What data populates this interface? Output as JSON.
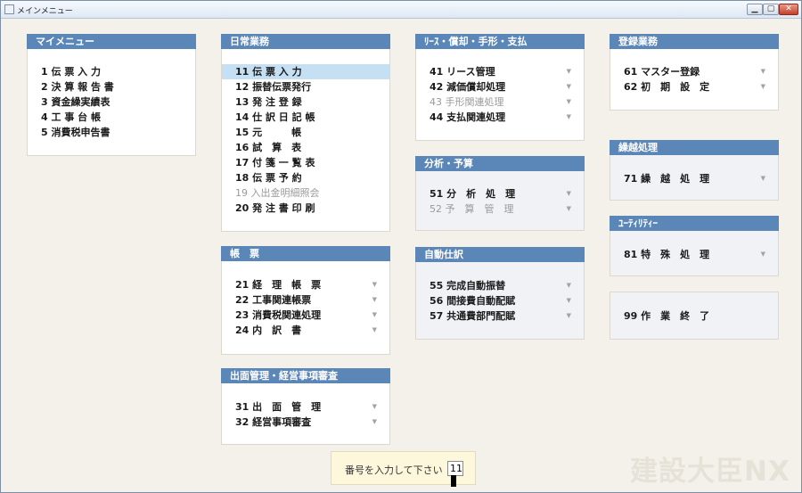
{
  "window": {
    "title": "メインメニュー",
    "controls": {
      "minimize": "▁",
      "maximize": "▢",
      "close": "✕"
    }
  },
  "panels": {
    "mymenu": {
      "title": "マイメニュー",
      "items": [
        {
          "label": "1 伝 票 入 力"
        },
        {
          "label": "2 決 算 報 告 書"
        },
        {
          "label": "3 資金繰実績表"
        },
        {
          "label": "4 工 事 台 帳"
        },
        {
          "label": "5 消費税申告書"
        }
      ]
    },
    "daily": {
      "title": "日常業務",
      "items": [
        {
          "label": "11 伝 票 入 力",
          "selected": true
        },
        {
          "label": "12 振替伝票発行"
        },
        {
          "label": "13 発 注 登 録"
        },
        {
          "label": "14 仕 訳 日 記 帳"
        },
        {
          "label": "15 元　　　帳"
        },
        {
          "label": "16 試　算　表"
        },
        {
          "label": "17 付 箋 一 覧 表"
        },
        {
          "label": "18 伝 票 予 約"
        },
        {
          "label": "19 入出金明細照会",
          "disabled": true
        },
        {
          "label": "20 発 注 書 印 刷"
        }
      ]
    },
    "ledger": {
      "title": "帳　票",
      "items": [
        {
          "label": "21 経　理　帳　票",
          "arrow": "▼"
        },
        {
          "label": "22 工事関連帳票",
          "arrow": "▼"
        },
        {
          "label": "23 消費税関連処理",
          "arrow": "▼"
        },
        {
          "label": "24 内　訳　書",
          "arrow": "▼"
        }
      ]
    },
    "audit": {
      "title": "出面管理・経営事項審査",
      "items": [
        {
          "label": "31 出　面　管　理",
          "arrow": "▼"
        },
        {
          "label": "32 経営事項審査",
          "arrow": "▼"
        }
      ]
    },
    "lease": {
      "title": "ﾘｰｽ・償却・手形・支払",
      "items": [
        {
          "label": "41 リース管理",
          "arrow": "▼"
        },
        {
          "label": "42 減価償却処理",
          "arrow": "▼"
        },
        {
          "label": "43 手形関連処理",
          "arrow": "▼",
          "disabled": true
        },
        {
          "label": "44 支払関連処理",
          "arrow": "▼"
        }
      ]
    },
    "analysis": {
      "title": "分析・予算",
      "items": [
        {
          "label": "51 分　析　処　理",
          "arrow": "▼"
        },
        {
          "label": "52 予　算　管　理",
          "arrow": "▼",
          "disabled": true
        }
      ]
    },
    "auto": {
      "title": "自動仕訳",
      "items": [
        {
          "label": "55 完成自動振替",
          "arrow": "▼"
        },
        {
          "label": "56 間接費自動配賦",
          "arrow": "▼"
        },
        {
          "label": "57 共通費部門配賦",
          "arrow": "▼"
        }
      ]
    },
    "registration": {
      "title": "登録業務",
      "items": [
        {
          "label": "61 マスター登録",
          "arrow": "▼"
        },
        {
          "label": "62 初　期　設　定",
          "arrow": "▼"
        }
      ]
    },
    "carryover": {
      "title": "繰越処理",
      "items": [
        {
          "label": "71 繰　越　処　理",
          "arrow": "▼"
        }
      ]
    },
    "utility": {
      "title": "ﾕｰﾃｨﾘﾃｨｰ",
      "items": [
        {
          "label": "81 特　殊　処　理",
          "arrow": "▼"
        }
      ]
    },
    "exit": {
      "items": [
        {
          "label": "99 作　業　終　了"
        }
      ]
    }
  },
  "number_input": {
    "label": "番号を入力して下さい",
    "value": "11"
  },
  "brand": "建設大臣NX",
  "colors": {
    "header": "#5b86b8",
    "selected": "#c5dff3",
    "background": "#f4f1ea"
  }
}
